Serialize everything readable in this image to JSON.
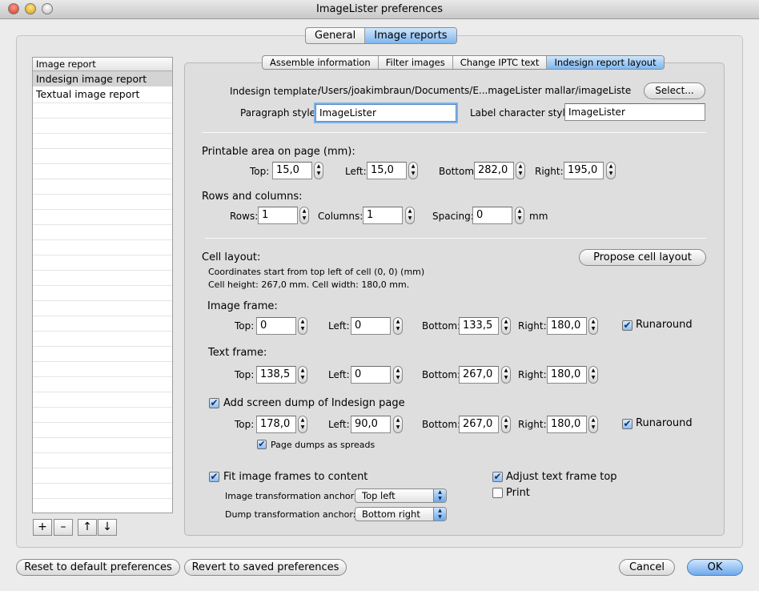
{
  "window": {
    "title": "ImageLister preferences"
  },
  "main_tabs": [
    {
      "label": "General"
    },
    {
      "label": "Image reports"
    }
  ],
  "sub_tabs": [
    {
      "label": "Assemble information"
    },
    {
      "label": "Filter images"
    },
    {
      "label": "Change IPTC text"
    },
    {
      "label": "Indesign report layout"
    }
  ],
  "report_list": {
    "header": "Image report",
    "items": [
      {
        "label": "Indesign image report"
      },
      {
        "label": "Textual image report"
      }
    ]
  },
  "list_buttons": {
    "add": "+",
    "remove": "–",
    "up": "↑",
    "down": "↓"
  },
  "template": {
    "label": "Indesign template:",
    "value": "/Users/joakimbraun/Documents/E...mageLister mallar/imageLister.indt",
    "select": "Select..."
  },
  "paragraph": {
    "label": "Paragraph style:",
    "value": "ImageLister"
  },
  "label_char": {
    "label": "Label character style:",
    "value": "ImageLister"
  },
  "printable": {
    "title": "Printable area on page (mm):",
    "top_label": "Top:",
    "top": "15,0",
    "left_label": "Left:",
    "left": "15,0",
    "bottom_label": "Bottom:",
    "bottom": "282,0",
    "right_label": "Right:",
    "right": "195,0"
  },
  "rowscols": {
    "title": "Rows and columns:",
    "rows_label": "Rows:",
    "rows": "1",
    "cols_label": "Columns:",
    "cols": "1",
    "spacing_label": "Spacing:",
    "spacing": "0",
    "unit": "mm"
  },
  "cell": {
    "title": "Cell layout:",
    "info1": "Coordinates start from top left of cell (0, 0) (mm)",
    "info2": "Cell height: 267,0 mm. Cell width: 180,0 mm.",
    "propose": "Propose cell layout"
  },
  "image_frame": {
    "title": "Image frame:",
    "top_label": "Top:",
    "top": "0",
    "left_label": "Left:",
    "left": "0",
    "bottom_label": "Bottom:",
    "bottom": "133,5",
    "right_label": "Right:",
    "right": "180,0",
    "runaround": "Runaround",
    "runaround_checked": true
  },
  "text_frame": {
    "title": "Text frame:",
    "top_label": "Top:",
    "top": "138,5",
    "left_label": "Left:",
    "left": "0",
    "bottom_label": "Bottom:",
    "bottom": "267,0",
    "right_label": "Right:",
    "right": "180,0"
  },
  "screen_dump": {
    "label": "Add screen dump of Indesign page",
    "checked": true,
    "top_label": "Top:",
    "top": "178,0",
    "left_label": "Left:",
    "left": "90,0",
    "bottom_label": "Bottom:",
    "bottom": "267,0",
    "right_label": "Right:",
    "right": "180,0",
    "runaround": "Runaround",
    "runaround_checked": true,
    "spreads": "Page dumps as spreads",
    "spreads_checked": true
  },
  "fit": {
    "label": "Fit image frames to content",
    "checked": true,
    "image_anchor_label": "Image transformation anchor:",
    "image_anchor": "Top left",
    "dump_anchor_label": "Dump transformation anchor:",
    "dump_anchor": "Bottom right"
  },
  "adjust": {
    "label": "Adjust text frame top",
    "checked": true
  },
  "print": {
    "label": "Print",
    "checked": false
  },
  "footer": {
    "reset": "Reset to default preferences",
    "revert": "Revert to saved preferences",
    "cancel": "Cancel",
    "ok": "OK"
  }
}
